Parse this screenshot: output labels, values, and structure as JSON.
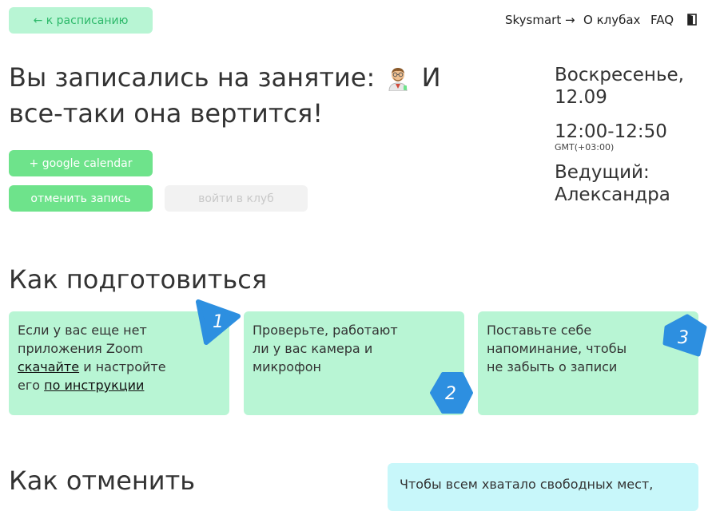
{
  "header": {
    "back_label": "← к расписанию",
    "nav": {
      "skysmart": "Skysmart →",
      "about": "О клубах",
      "faq": "FAQ",
      "exit_icon": "exit-door-icon"
    }
  },
  "main": {
    "title_prefix": "Вы записались на занятие:",
    "title_suffix": "И все-таки она вертится!",
    "title_icon": "scientist-emoji-icon",
    "buttons": {
      "google_calendar": "+ google calendar",
      "cancel": "отменить запись",
      "join_club": "войти в клуб"
    }
  },
  "session": {
    "date_line1": "Воскресенье,",
    "date_line2": "12.09",
    "time": "12:00-12:50",
    "timezone": "GMT(+03:00)",
    "host_label": "Ведущий:",
    "host_name": "Александра"
  },
  "prepare": {
    "heading": "Как подготовиться",
    "cards": [
      {
        "number": "1",
        "text_a": "Если у вас еще нет приложения Zoom",
        "link1": "скачайте",
        "text_b": "и настройте его",
        "link2": "по инструкции"
      },
      {
        "number": "2",
        "text": "Проверьте, работают ли у вас камера и микрофон"
      },
      {
        "number": "3",
        "text": "Поставьте себе напоминание, чтобы не забыть о записи"
      }
    ]
  },
  "cancel_section": {
    "heading": "Как отменить",
    "text": "Чтобы всем хватало свободных мест,"
  },
  "colors": {
    "mint": "#b8f5d4",
    "green_button": "#6ee38b",
    "badge_blue": "#2d8fe0",
    "light_cyan": "#c8f7fa"
  }
}
